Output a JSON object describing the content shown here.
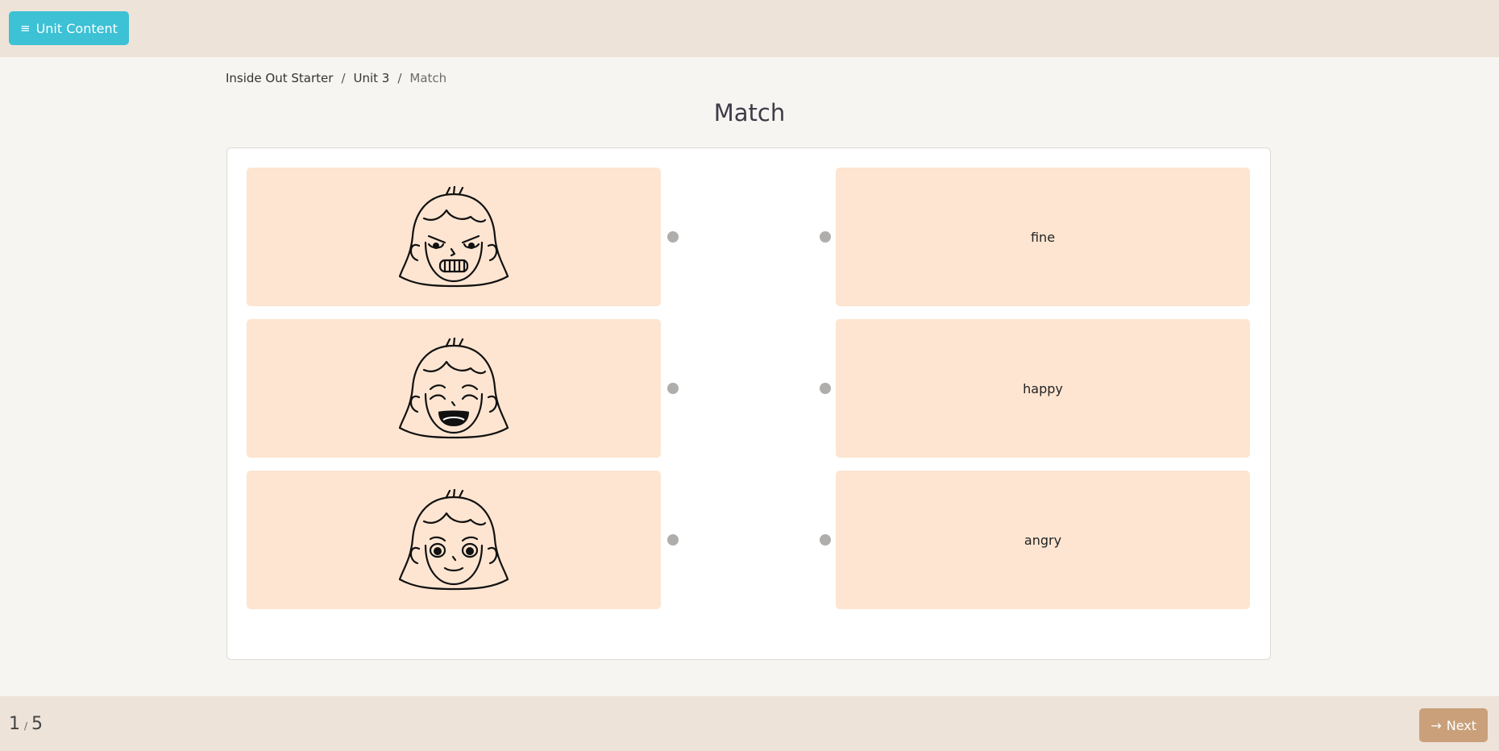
{
  "header": {
    "unit_content_label": "Unit Content",
    "menu_icon": "≡"
  },
  "breadcrumb": {
    "items": [
      "Inside Out Starter",
      "Unit 3"
    ],
    "current": "Match",
    "separator": "/"
  },
  "page": {
    "title": "Match"
  },
  "exercise": {
    "left_items": [
      {
        "image": "angry-face-icon"
      },
      {
        "image": "happy-face-icon"
      },
      {
        "image": "fine-face-icon"
      }
    ],
    "right_items": [
      {
        "label": "fine"
      },
      {
        "label": "happy"
      },
      {
        "label": "angry"
      }
    ]
  },
  "footer": {
    "current_page": "1",
    "total_pages": "5",
    "slash": "/",
    "next_label": "Next",
    "next_icon": "→"
  },
  "colors": {
    "accent": "#3cc1d5",
    "card_bg": "#fde5d1",
    "bar_bg": "#ede3d9",
    "next_bg": "#c9a07a",
    "dot": "#b0aeac"
  }
}
